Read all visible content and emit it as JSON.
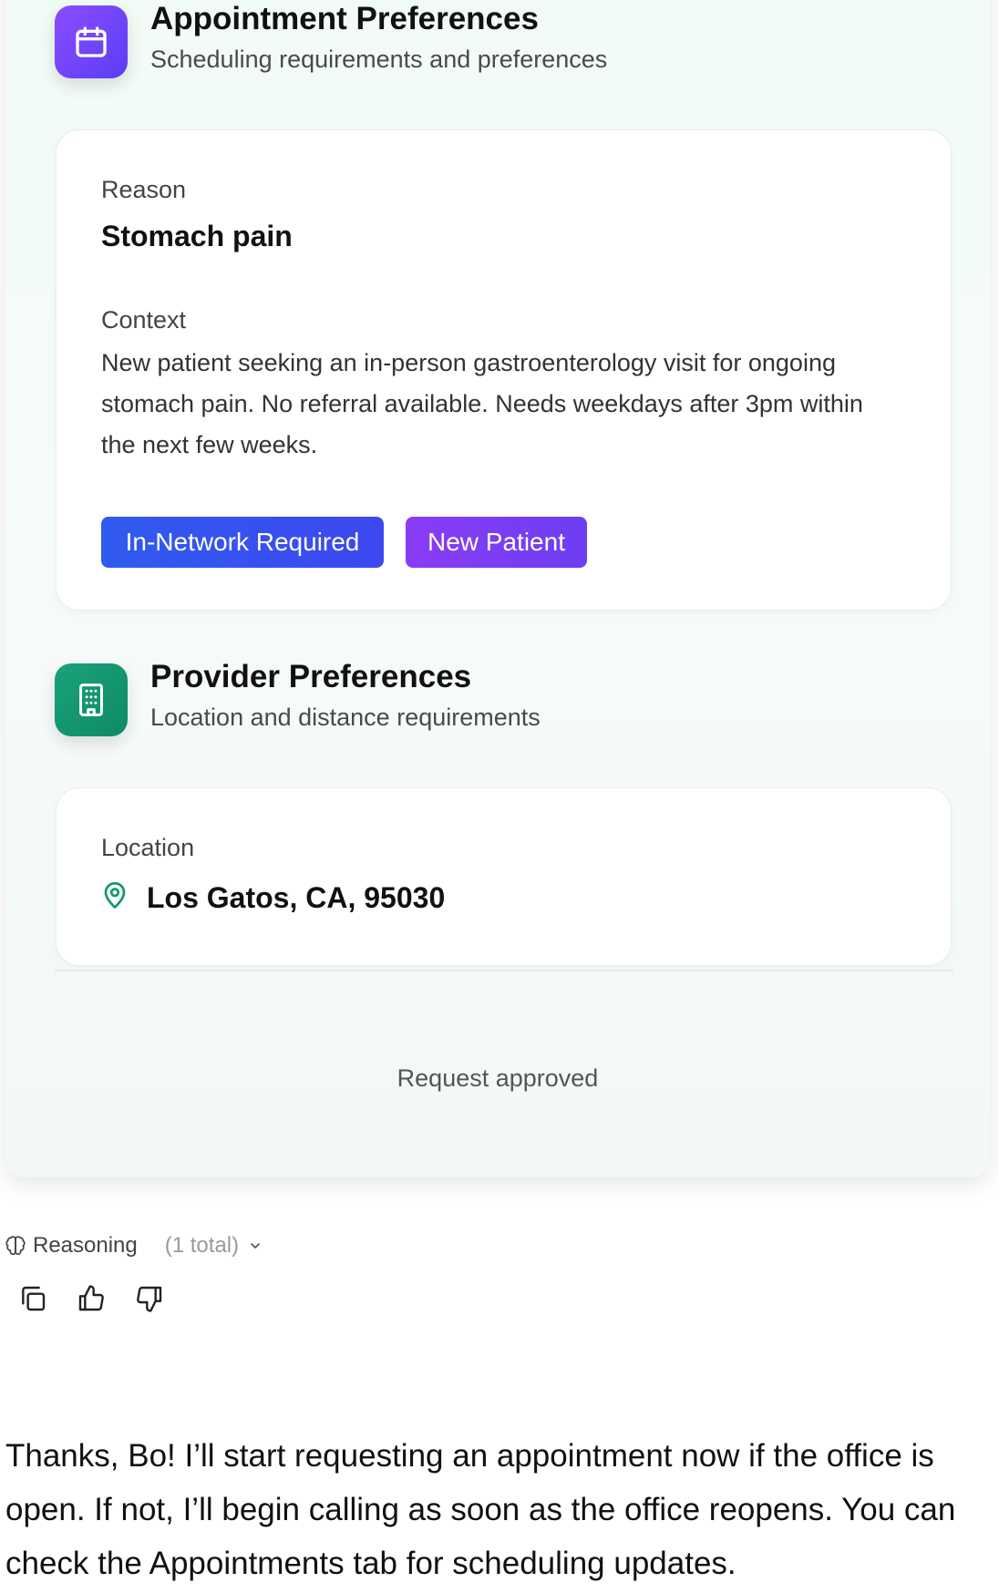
{
  "appointment": {
    "title": "Appointment Preferences",
    "subtitle": "Scheduling requirements and preferences",
    "reason_label": "Reason",
    "reason_value": "Stomach pain",
    "context_label": "Context",
    "context_value": "New patient seeking an in-person gastroenterology visit for ongoing stomach pain. No referral available. Needs weekdays after 3pm within the next few weeks.",
    "tags": [
      "In-Network Required",
      "New Patient"
    ],
    "icon": "calendar-icon"
  },
  "provider": {
    "title": "Provider Preferences",
    "subtitle": "Location and distance requirements",
    "location_label": "Location",
    "location_value": "Los Gatos, CA, 95030",
    "icon": "building-icon"
  },
  "status": "Request approved",
  "reasoning": {
    "label": "Reasoning",
    "count": "(1 total)"
  },
  "message": "Thanks, Bo! I’ll start requesting an appointment now if the office is open. If not, I’ll begin calling as soon as the office reopens. You can check the Appointments tab for scheduling updates.",
  "colors": {
    "accent_purple": "#7b45f8",
    "accent_green": "#14976f",
    "tag_blue": "#3552ef",
    "tag_purple": "#7f3df4"
  }
}
